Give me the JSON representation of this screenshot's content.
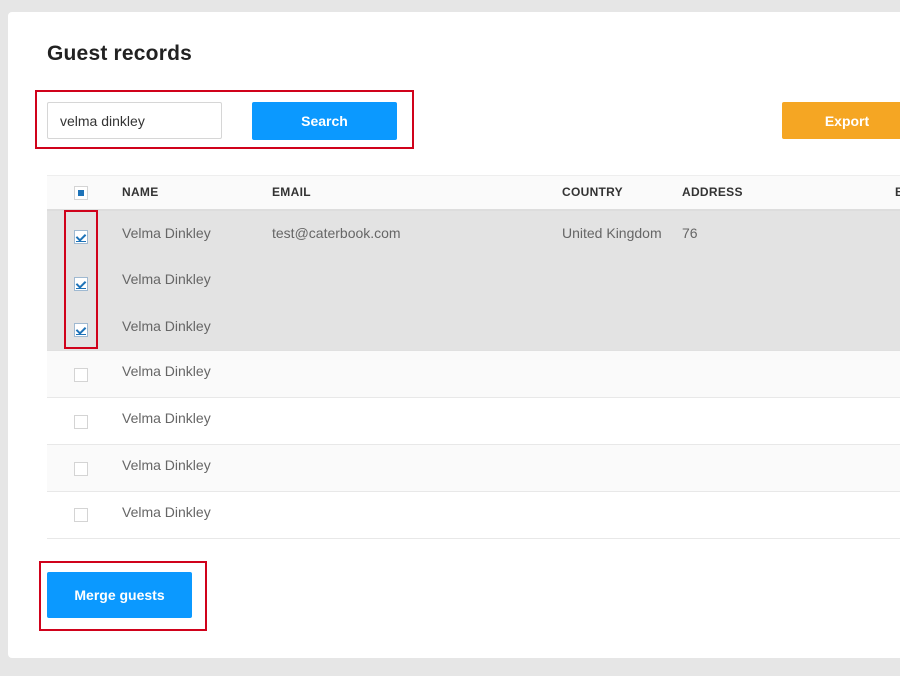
{
  "page": {
    "title": "Guest records"
  },
  "search": {
    "value": "velma dinkley",
    "button_label": "Search"
  },
  "toolbar": {
    "export_label": "Export"
  },
  "table": {
    "columns": [
      "NAME",
      "EMAIL",
      "COUNTRY",
      "ADDRESS",
      "B"
    ],
    "rows": [
      {
        "selected": true,
        "name": "Velma Dinkley",
        "email": "test@caterbook.com",
        "country": "United Kingdom",
        "address": "76"
      },
      {
        "selected": true,
        "name": "Velma Dinkley",
        "email": "",
        "country": "",
        "address": ""
      },
      {
        "selected": true,
        "name": "Velma Dinkley",
        "email": "",
        "country": "",
        "address": ""
      },
      {
        "selected": false,
        "name": "Velma Dinkley",
        "email": "",
        "country": "",
        "address": ""
      },
      {
        "selected": false,
        "name": "Velma Dinkley",
        "email": "",
        "country": "",
        "address": ""
      },
      {
        "selected": false,
        "name": "Velma Dinkley",
        "email": "",
        "country": "",
        "address": ""
      },
      {
        "selected": false,
        "name": "Velma Dinkley",
        "email": "",
        "country": "",
        "address": ""
      }
    ]
  },
  "actions": {
    "merge_label": "Merge guests"
  },
  "colors": {
    "primary": "#0b99ff",
    "export": "#f5a623",
    "highlight": "#d0021b",
    "selected_row": "#e3e3e3"
  }
}
